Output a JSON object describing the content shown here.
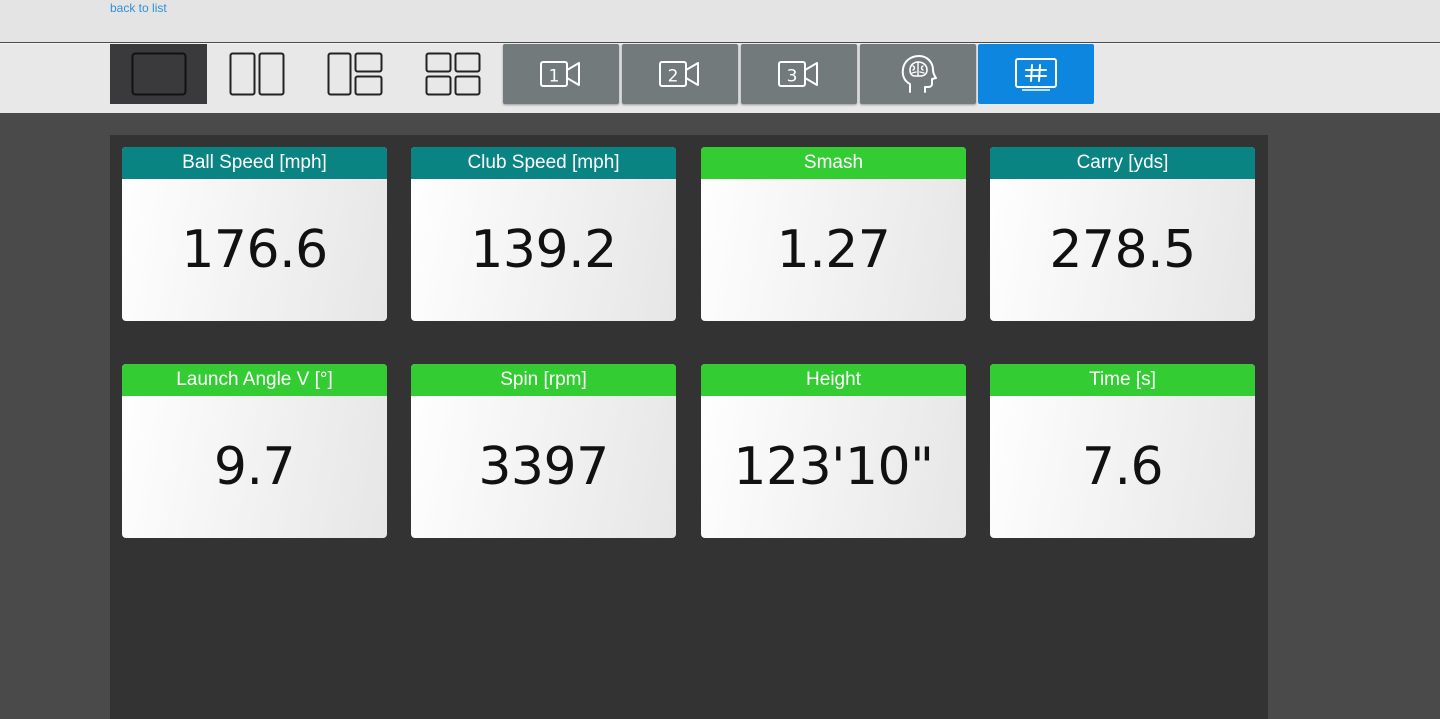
{
  "nav": {
    "back_label": "back to list"
  },
  "toolbar": {
    "layout_buttons": [
      {
        "icon": "single-view-icon",
        "active": true
      },
      {
        "icon": "two-column-view-icon",
        "active": false
      },
      {
        "icon": "three-panel-view-icon",
        "active": false
      },
      {
        "icon": "four-panel-view-icon",
        "active": false
      }
    ],
    "camera_buttons": [
      {
        "label": "1",
        "icon": "camera-icon"
      },
      {
        "label": "2",
        "icon": "camera-icon"
      },
      {
        "label": "3",
        "icon": "camera-icon"
      }
    ],
    "brain_button": {
      "icon": "brain-head-icon"
    },
    "data_button": {
      "icon": "hash-icon",
      "active": true,
      "color": "#0d86e0"
    }
  },
  "metrics": [
    {
      "label": "Ball Speed [mph]",
      "value": "176.6",
      "header_color": "#0a8383"
    },
    {
      "label": "Club Speed [mph]",
      "value": "139.2",
      "header_color": "#0a8383"
    },
    {
      "label": "Smash",
      "value": "1.27",
      "header_color": "#33cc33"
    },
    {
      "label": "Carry [yds]",
      "value": "278.5",
      "header_color": "#0a8383"
    },
    {
      "label": "Launch Angle V [°]",
      "value": "9.7",
      "header_color": "#33cc33"
    },
    {
      "label": "Spin [rpm]",
      "value": "3397",
      "header_color": "#33cc33"
    },
    {
      "label": "Height",
      "value": "123'10\"",
      "header_color": "#33cc33"
    },
    {
      "label": "Time [s]",
      "value": "7.6",
      "header_color": "#33cc33"
    }
  ]
}
